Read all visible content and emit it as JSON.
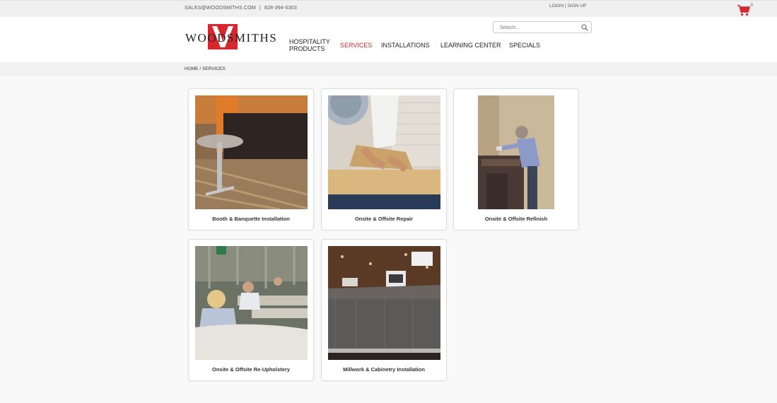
{
  "topbar": {
    "email": "SALES@WOODSMITHS.COM",
    "separator": "|",
    "phone": "828-394-0303",
    "login": "LOGIN",
    "auth_separator": "|",
    "signup": "SIGN UP",
    "cart_count": "0"
  },
  "header": {
    "logo_text": "WOODSMITHS",
    "search_placeholder": "Search...",
    "nav": [
      {
        "label_line1": "HOSPITALITY",
        "label_line2": "PRODUCTS",
        "active": false
      },
      {
        "label_line1": "SERVICES",
        "label_line2": "",
        "active": true
      },
      {
        "label_line1": "INSTALLATIONS",
        "label_line2": "",
        "active": false
      },
      {
        "label_line1": "LEARNING CENTER",
        "label_line2": "",
        "active": false
      },
      {
        "label_line1": "SPECIALS",
        "label_line2": "",
        "active": false
      }
    ]
  },
  "breadcrumb": {
    "home": "HOME",
    "separator": "/",
    "current": "SERVICES"
  },
  "services": [
    {
      "label": "Booth & Banquette Installation",
      "image": "booth-banquette-photo"
    },
    {
      "label": "Onsite & Offsite Repair",
      "image": "woodworking-repair-photo"
    },
    {
      "label": "Onsite & Offsite Refinish",
      "image": "spray-refinish-photo"
    },
    {
      "label": "Onsite & Offsite Re-Upholstery",
      "image": "upholstery-workshop-photo"
    },
    {
      "label": "Millwork & Cabinetry Installation",
      "image": "millwork-counter-photo"
    }
  ],
  "colors": {
    "accent": "#d7282f",
    "text": "#222222",
    "background": "#f9f9f9"
  }
}
